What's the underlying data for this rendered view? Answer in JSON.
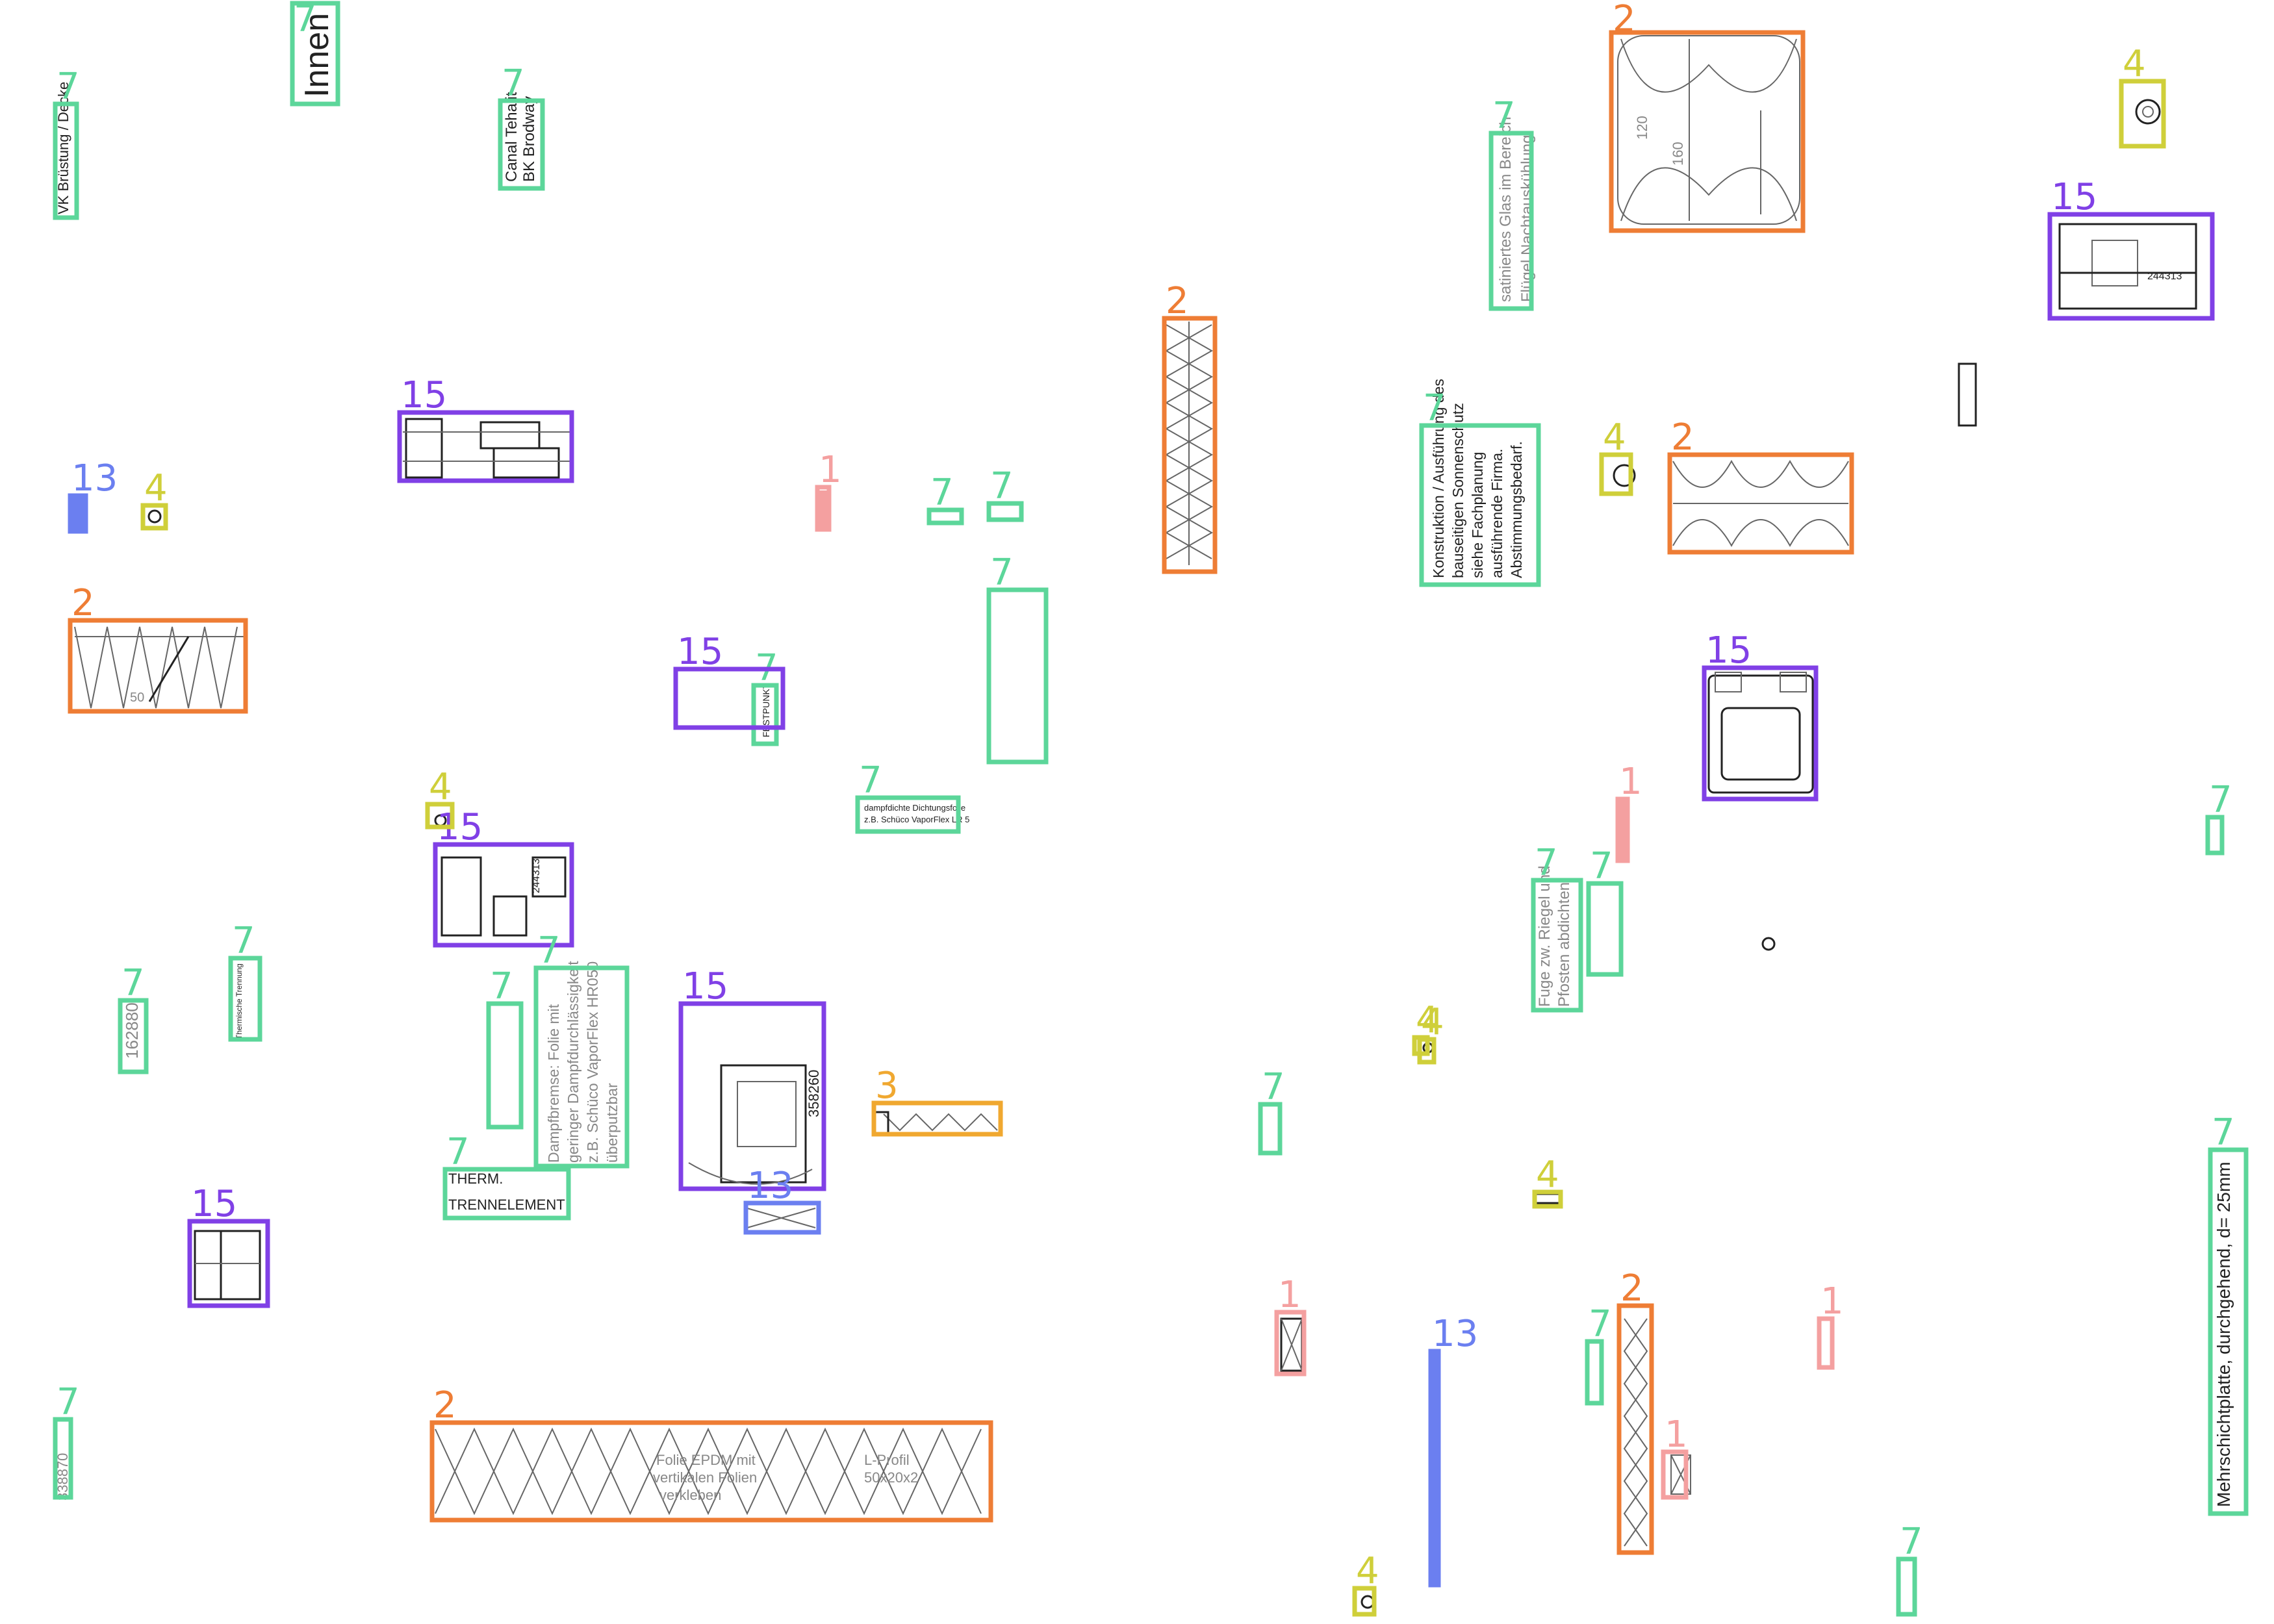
{
  "colors": {
    "1": "#f4a0a0",
    "2": "#ee7d35",
    "3": "#f0a830",
    "4": "#cfcf3a",
    "7": "#5cd69a",
    "13": "#6b7ff0",
    "15": "#8040e6"
  },
  "legend_labels": {
    "1": "1",
    "2": "2",
    "3": "3",
    "4": "4",
    "7": "7",
    "13": "13",
    "15": "15"
  },
  "drawing_texts": {
    "vk_bruestung": "VK Brüstung / Decke",
    "innen": "Innen",
    "canal_tehalit": "Canal Tehalit",
    "bk_brodway": "BK Brodway",
    "satiniertes_glas": "satiniertes Glas im Bereich",
    "fluegel_nacht": "Flügel Nachtauskühlung",
    "konstruktion": "Konstruktion / Ausführung des",
    "bauseitigen": "bauseitigen Sonnenschutz",
    "siehe_fachplanung": "siehe Fachplanung",
    "ausfuehrende_firma": "ausführende Firma.",
    "abstimmungsbedarf": "Abstimmungsbedarf.",
    "festpunkt": "FESTPUNKT",
    "dampfdichte": "dampfdichte Dichtungsfolie",
    "schueco_lr5": "z.B. Schüco VaporFlex LR 5",
    "fuge_riegel": "Fuge zw. Riegel und",
    "pfosten_abdichten": "Pfosten abdichten",
    "nr_162880": "162880",
    "thermische_trennung": "Thermische Trennung",
    "dampfbremse_1": "Dampfbremse: Folie mit",
    "dampfbremse_2": "geringer Dampfdurchlässigkeit",
    "dampfbremse_3": "z.B. Schüco VaporFlex HR050",
    "dampfbremse_4": "überputzbar",
    "therm": "THERM.",
    "trennelement": "TRENNELEMENT",
    "nr_358260": "358260",
    "nr_338870": "338870",
    "folie_epdm_1": "Folie EPDM mit",
    "folie_epdm_2": "vertikalen Folien",
    "folie_epdm_3": "verkleben",
    "l_profil_1": "L-Profil",
    "l_profil_2": "50x20x2",
    "mehrschichtplatte": "Mehrschichtplatte, durchgehend, d= 25mm",
    "dim_120": "120",
    "dim_160": "160",
    "dim_50": "50",
    "nr_244312": "244313"
  },
  "boxes": [
    {
      "cls": "7"
    },
    {
      "cls": "7"
    },
    {
      "cls": "7"
    },
    {
      "cls": "2"
    },
    {
      "cls": "4"
    },
    {
      "cls": "15"
    },
    {
      "cls": "7"
    },
    {
      "cls": "4"
    },
    {
      "cls": "2"
    },
    {
      "cls": "15"
    },
    {
      "cls": "7"
    },
    {
      "cls": "2"
    },
    {
      "cls": "13"
    },
    {
      "cls": "4"
    },
    {
      "cls": "15"
    },
    {
      "cls": "1"
    },
    {
      "cls": "7"
    },
    {
      "cls": "7"
    },
    {
      "cls": "2"
    },
    {
      "cls": "15"
    },
    {
      "cls": "7"
    },
    {
      "cls": "7"
    },
    {
      "cls": "4"
    },
    {
      "cls": "15"
    },
    {
      "cls": "1"
    },
    {
      "cls": "7"
    },
    {
      "cls": "7"
    },
    {
      "cls": "7"
    },
    {
      "cls": "7"
    },
    {
      "cls": "4"
    },
    {
      "cls": "7"
    },
    {
      "cls": "7"
    },
    {
      "cls": "4"
    },
    {
      "cls": "7"
    },
    {
      "cls": "15"
    },
    {
      "cls": "3"
    },
    {
      "cls": "7"
    },
    {
      "cls": "13"
    },
    {
      "cls": "7"
    },
    {
      "cls": "4"
    },
    {
      "cls": "15"
    },
    {
      "cls": "7"
    },
    {
      "cls": "1"
    },
    {
      "cls": "13"
    },
    {
      "cls": "2"
    },
    {
      "cls": "7"
    },
    {
      "cls": "1"
    },
    {
      "cls": "2"
    },
    {
      "cls": "1"
    },
    {
      "cls": "7"
    },
    {
      "cls": "7"
    },
    {
      "cls": "4"
    },
    {
      "cls": "7"
    }
  ]
}
